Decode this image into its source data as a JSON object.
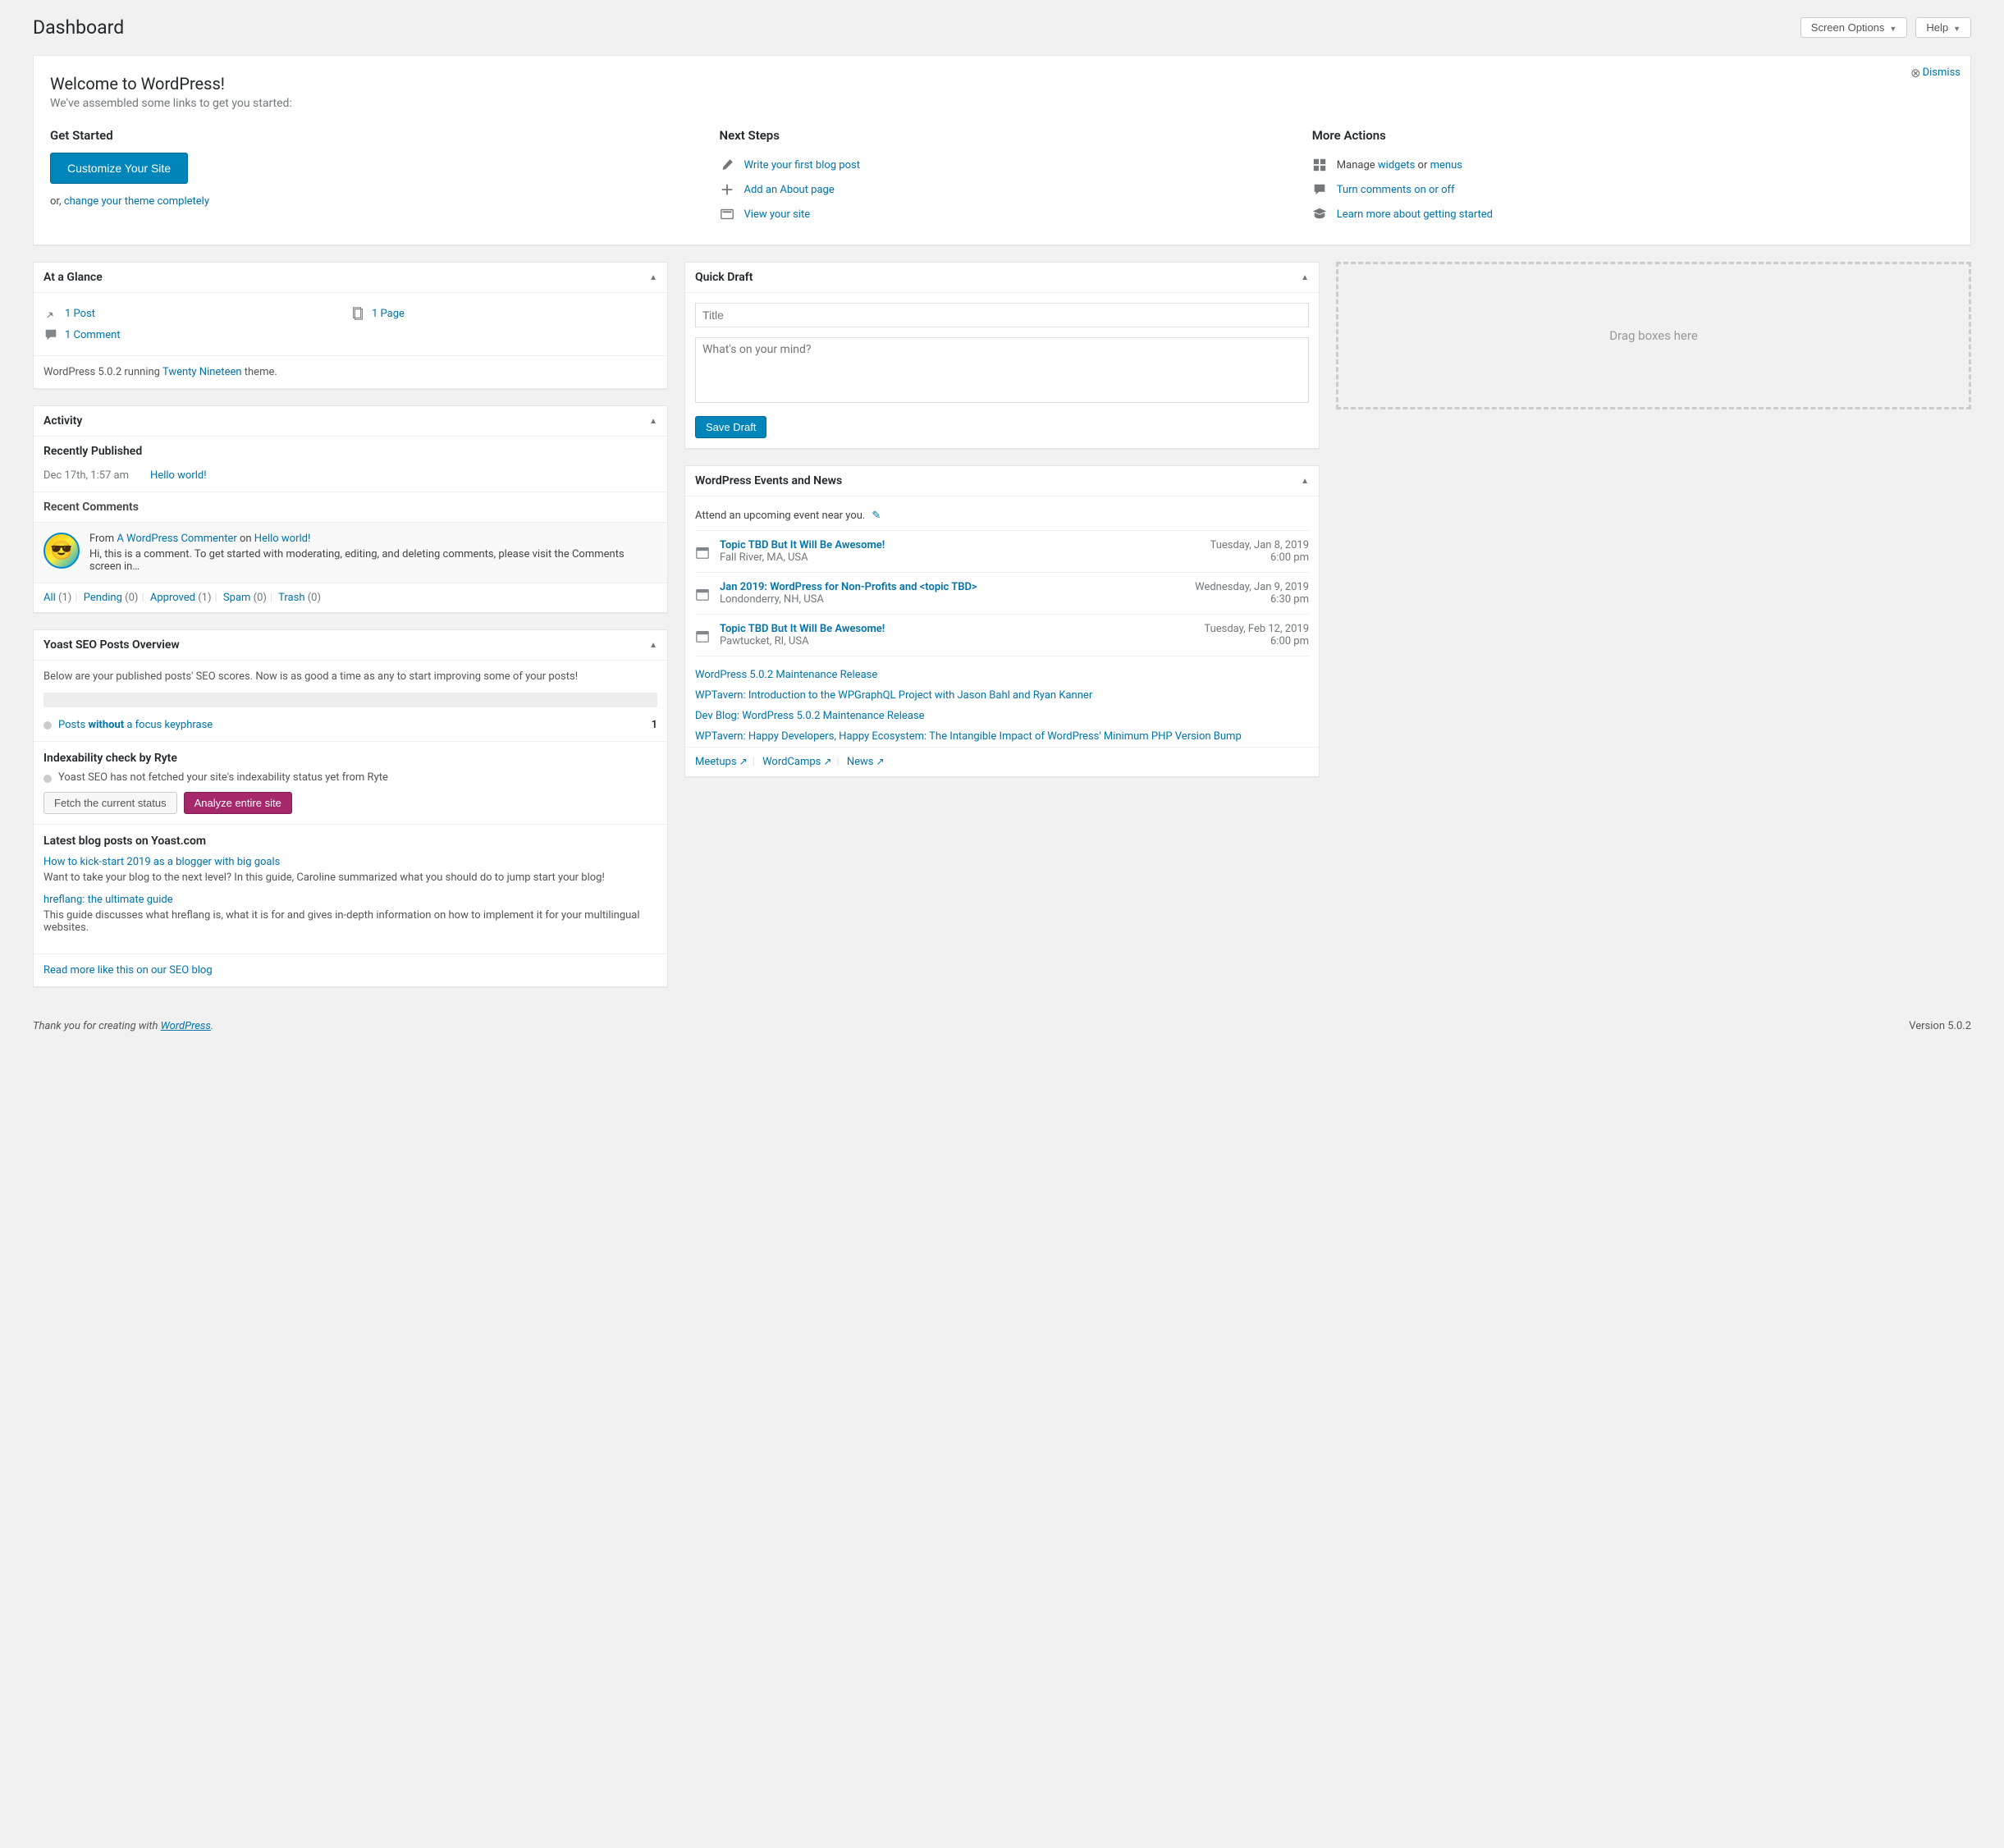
{
  "header": {
    "title": "Dashboard",
    "screen_options": "Screen Options",
    "help": "Help"
  },
  "welcome": {
    "title": "Welcome to WordPress!",
    "subtitle": "We've assembled some links to get you started:",
    "dismiss": "Dismiss",
    "get_started": {
      "heading": "Get Started",
      "button": "Customize Your Site",
      "or_prefix": "or, ",
      "or_link": "change your theme completely"
    },
    "next_steps": {
      "heading": "Next Steps",
      "items": [
        "Write your first blog post",
        "Add an About page",
        "View your site"
      ]
    },
    "more_actions": {
      "heading": "More Actions",
      "manage_prefix": "Manage ",
      "widgets": "widgets",
      "or": " or ",
      "menus": "menus",
      "comments_link": "Turn comments on or off",
      "learn_link": "Learn more about getting started"
    }
  },
  "glance": {
    "title": "At a Glance",
    "posts": "1 Post",
    "pages": "1 Page",
    "comments": "1 Comment",
    "version_prefix": "WordPress 5.0.2 running ",
    "theme": "Twenty Nineteen",
    "version_suffix": " theme."
  },
  "activity": {
    "title": "Activity",
    "recently_published": "Recently Published",
    "pub_date": "Dec 17th, 1:57 am",
    "pub_title": "Hello world!",
    "recent_comments": "Recent Comments",
    "comment_from": "From ",
    "comment_author": "A WordPress Commenter",
    "comment_on": " on ",
    "comment_post": "Hello world!",
    "comment_body": "Hi, this is a comment. To get started with moderating, editing, and deleting comments, please visit the Comments screen in…",
    "filters": {
      "all": "All",
      "all_count": " (1)",
      "pending": "Pending",
      "pending_count": " (0)",
      "approved": "Approved",
      "approved_count": " (1)",
      "spam": "Spam",
      "spam_count": " (0)",
      "trash": "Trash",
      "trash_count": " (0)"
    }
  },
  "yoast": {
    "title": "Yoast SEO Posts Overview",
    "desc": "Below are your published posts' SEO scores. Now is as good a time as any to start improving some of your posts!",
    "row_prefix": "Posts ",
    "row_bold": "without",
    "row_suffix": " a focus keyphrase",
    "row_count": "1",
    "ryte_heading": "Indexability check by Ryte",
    "ryte_text": "Yoast SEO has not fetched your site's indexability status yet from Ryte",
    "btn_fetch": "Fetch the current status",
    "btn_analyze": "Analyze entire site",
    "blog_heading": "Latest blog posts on Yoast.com",
    "blog_items": [
      {
        "title": "How to kick-start 2019 as a blogger with big goals",
        "desc": "Want to take your blog to the next level? In this guide, Caroline summarized what you should do to jump start your blog!"
      },
      {
        "title": "hreflang: the ultimate guide",
        "desc": "This guide discusses what hreflang is, what it is for and gives in-depth information on how to implement it for your multilingual websites."
      }
    ],
    "blog_more": "Read more like this on our SEO blog"
  },
  "quickdraft": {
    "title": "Quick Draft",
    "title_placeholder": "Title",
    "content_placeholder": "What's on your mind?",
    "save": "Save Draft"
  },
  "events": {
    "title": "WordPress Events and News",
    "near": "Attend an upcoming event near you.",
    "items": [
      {
        "title": "Topic TBD But It Will Be Awesome!",
        "loc": "Fall River, MA, USA",
        "date": "Tuesday, Jan 8, 2019",
        "time": "6:00 pm"
      },
      {
        "title": "Jan 2019: WordPress for Non-Profits and <topic TBD>",
        "loc": "Londonderry, NH, USA",
        "date": "Wednesday, Jan 9, 2019",
        "time": "6:30 pm"
      },
      {
        "title": "Topic TBD But It Will Be Awesome!",
        "loc": "Pawtucket, RI, USA",
        "date": "Tuesday, Feb 12, 2019",
        "time": "6:00 pm"
      }
    ],
    "news": [
      "WordPress 5.0.2 Maintenance Release",
      "WPTavern: Introduction to the WPGraphQL Project with Jason Bahl and Ryan Kanner",
      "Dev Blog: WordPress 5.0.2 Maintenance Release",
      "WPTavern: Happy Developers, Happy Ecosystem: The Intangible Impact of WordPress' Minimum PHP Version Bump"
    ],
    "footer": {
      "meetups": "Meetups",
      "wordcamps": "WordCamps",
      "newslink": "News"
    }
  },
  "dropzone": "Drag boxes here",
  "footer": {
    "thank_prefix": "Thank you for creating with ",
    "wp": "WordPress",
    "thank_suffix": ".",
    "version": "Version 5.0.2"
  }
}
